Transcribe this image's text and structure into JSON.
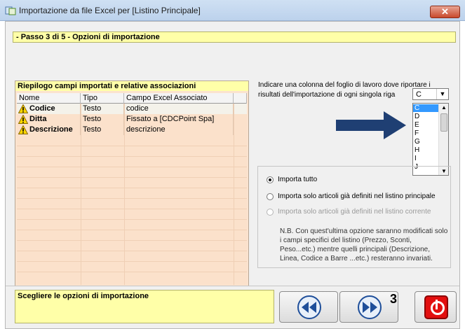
{
  "window": {
    "title": "Importazione da file Excel per [Listino Principale]",
    "close_glyph": "✕"
  },
  "step": {
    "label": "- Passo 3 di 5 - Opzioni di importazione"
  },
  "fields_panel": {
    "title": "Riepilogo campi importati e relative associazioni",
    "columns": [
      "Nome",
      "Tipo",
      "Campo Excel Associato"
    ],
    "rows": [
      {
        "name": "Codice",
        "type": "Testo",
        "excel": "codice",
        "icon": "warning-icon"
      },
      {
        "name": "Ditta",
        "type": "Testo",
        "excel": "Fissato a [CDCPoint Spa]",
        "icon": "warning-icon"
      },
      {
        "name": "Descrizione",
        "type": "Testo",
        "excel": "descrizione",
        "icon": "warning-icon"
      }
    ]
  },
  "column_select": {
    "instruction": "Indicare una colonna del foglio di lavoro dove riportare i risultati dell'importazione di ogni singola riga",
    "selected": "C",
    "options": [
      "C",
      "D",
      "E",
      "F",
      "G",
      "H",
      "I",
      "J"
    ]
  },
  "import_options": {
    "radios": [
      {
        "label": "Importa tutto",
        "checked": true,
        "enabled": true
      },
      {
        "label": "Importa solo articoli già definiti nel listino principale",
        "checked": false,
        "enabled": true
      },
      {
        "label": "Importa solo articoli già definiti nel listino corrente",
        "checked": false,
        "enabled": false
      }
    ],
    "note": "N.B. Con quest'ultima opzione saranno modificati solo i campi specifici del listino  (Prezzo, Sconti, Peso...etc.) mentre quelli principali (Descrizione, Linea, Codice a Barre ...etc.) resteranno invariati."
  },
  "status": {
    "message": "Scegliere le opzioni di importazione"
  },
  "nav": {
    "step_number": "3"
  },
  "colors": {
    "accent_yellow": "#ffffa8",
    "grid_bg": "#fbe1cb",
    "arrow": "#1f3f73",
    "exit_red": "#e30f0f"
  }
}
